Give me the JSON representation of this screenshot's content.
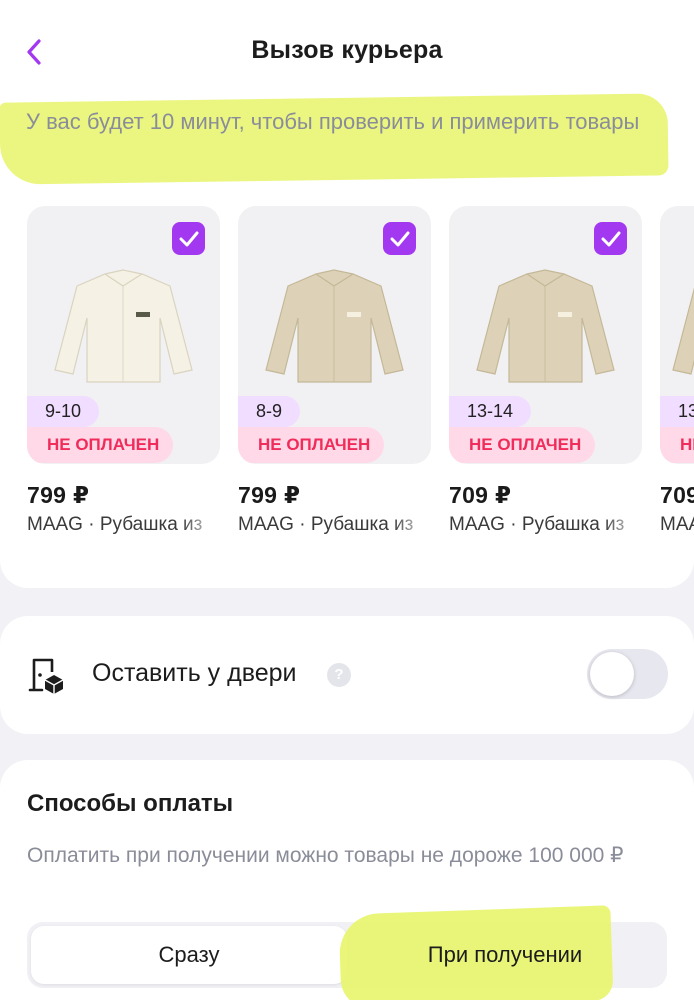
{
  "header": {
    "title": "Вызов курьера",
    "back_icon": "chevron-left-icon"
  },
  "info": {
    "text": "У вас будет 10 минут, чтобы проверить и примерить товары"
  },
  "products": [
    {
      "size": "9-10",
      "status": "НЕ ОПЛАЧЕН",
      "price": "799 ₽",
      "name": "MAAG · Рубашка из",
      "checked": true,
      "color": "#f3efe2"
    },
    {
      "size": "8-9",
      "status": "НЕ ОПЛАЧЕН",
      "price": "799 ₽",
      "name": "MAAG · Рубашка из",
      "checked": true,
      "color": "#dcd1b6"
    },
    {
      "size": "13-14",
      "status": "НЕ ОПЛАЧЕН",
      "price": "709 ₽",
      "name": "MAAG · Рубашка из",
      "checked": true,
      "color": "#dcd1b6"
    },
    {
      "size": "13",
      "status": "НЕ",
      "price": "709",
      "name": "MAAG",
      "checked": true,
      "color": "#dcd1b6"
    }
  ],
  "door": {
    "label": "Оставить у двери",
    "help": "?",
    "enabled": false
  },
  "payment": {
    "title": "Способы оплаты",
    "note": "Оплатить при получении можно товары не дороже 100 000 ₽",
    "options": [
      "Сразу",
      "При получении"
    ],
    "selected": "Сразу"
  },
  "colors": {
    "accent": "#a238ef",
    "status_text": "#f02c5b",
    "status_bg": "#ffd9e8",
    "size_bg": "#f1ddff",
    "highlighter": "#e8f56a"
  }
}
